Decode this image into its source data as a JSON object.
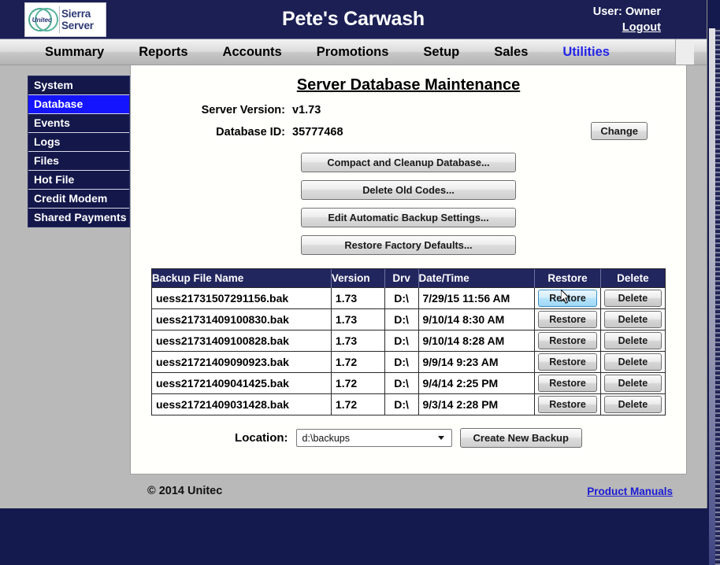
{
  "header": {
    "logo_unitec": "Unitec",
    "logo_line1": "Sierra",
    "logo_line2": "Server",
    "app_title": "Pete's Carwash",
    "user_label": "User: Owner",
    "logout_label": "Logout"
  },
  "nav": {
    "items": [
      {
        "label": "Summary",
        "active": false
      },
      {
        "label": "Reports",
        "active": false
      },
      {
        "label": "Accounts",
        "active": false
      },
      {
        "label": "Promotions",
        "active": false
      },
      {
        "label": "Setup",
        "active": false
      },
      {
        "label": "Sales",
        "active": false
      },
      {
        "label": "Utilities",
        "active": true
      }
    ]
  },
  "sidebar": {
    "items": [
      {
        "label": "System",
        "active": false
      },
      {
        "label": "Database",
        "active": true
      },
      {
        "label": "Events",
        "active": false
      },
      {
        "label": "Logs",
        "active": false
      },
      {
        "label": "Files",
        "active": false
      },
      {
        "label": "Hot File",
        "active": false
      },
      {
        "label": "Credit Modem",
        "active": false
      },
      {
        "label": "Shared Payments",
        "active": false
      }
    ]
  },
  "main": {
    "title": "Server Database Maintenance",
    "server_version_label": "Server Version:",
    "server_version_value": "v1.73",
    "database_id_label": "Database ID:",
    "database_id_value": "35777468",
    "change_button": "Change",
    "actions": [
      "Compact and Cleanup Database...",
      "Delete Old Codes...",
      "Edit Automatic Backup Settings...",
      "Restore Factory Defaults..."
    ],
    "table": {
      "columns": [
        "Backup File Name",
        "Version",
        "Drv",
        "Date/Time",
        "Restore",
        "Delete"
      ],
      "restore_label": "Restore",
      "delete_label": "Delete",
      "rows": [
        {
          "name": "uess21731507291156.bak",
          "version": "1.73",
          "drv": "D:\\",
          "datetime": "7/29/15 11:56 AM",
          "restore_hover": true
        },
        {
          "name": "uess21731409100830.bak",
          "version": "1.73",
          "drv": "D:\\",
          "datetime": "9/10/14 8:30 AM",
          "restore_hover": false
        },
        {
          "name": "uess21731409100828.bak",
          "version": "1.73",
          "drv": "D:\\",
          "datetime": "9/10/14 8:28 AM",
          "restore_hover": false
        },
        {
          "name": "uess21721409090923.bak",
          "version": "1.72",
          "drv": "D:\\",
          "datetime": "9/9/14 9:23 AM",
          "restore_hover": false
        },
        {
          "name": "uess21721409041425.bak",
          "version": "1.72",
          "drv": "D:\\",
          "datetime": "9/4/14 2:25 PM",
          "restore_hover": false
        },
        {
          "name": "uess21721409031428.bak",
          "version": "1.72",
          "drv": "D:\\",
          "datetime": "9/3/14 2:28 PM",
          "restore_hover": false
        }
      ]
    },
    "location_label": "Location:",
    "location_value": "d:\\backups",
    "create_backup_button": "Create New Backup"
  },
  "footer": {
    "copyright": "© 2014 Unitec",
    "product_manuals": "Product Manuals"
  },
  "colors": {
    "header_navy": "#1b1f54",
    "sidebar_navy": "#13174a",
    "active_blue": "#1414ff",
    "nav_active_text": "#2323e8",
    "table_header": "#22265e",
    "link_blue": "#1b1bd4",
    "page_bg": "#151a4e",
    "chrome_gray": "#b9b9b9"
  }
}
